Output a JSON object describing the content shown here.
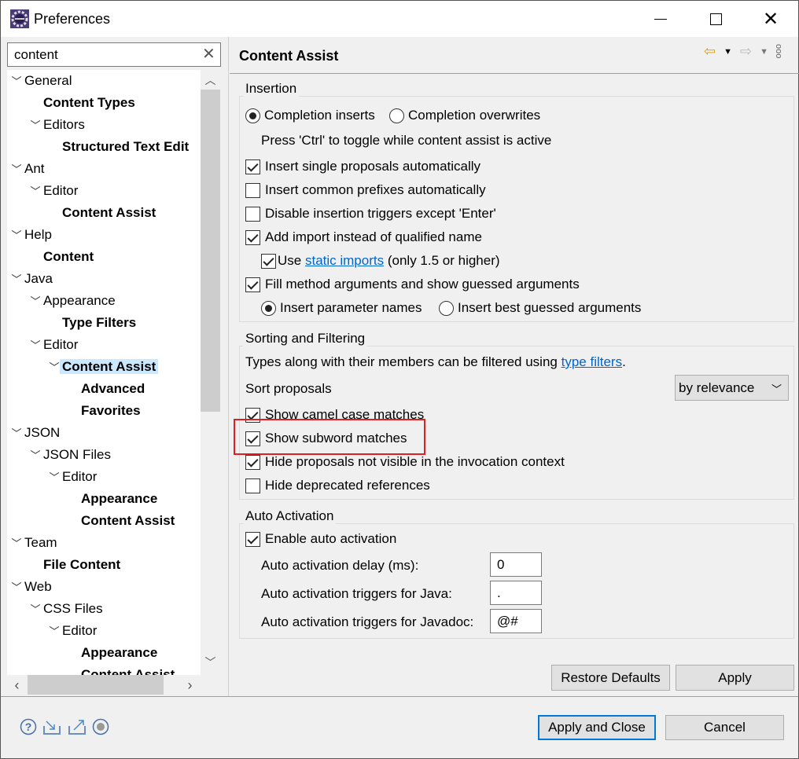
{
  "window": {
    "title": "Preferences",
    "icon": "eclipse-gear-icon",
    "controls": [
      "minimize",
      "maximize",
      "close"
    ]
  },
  "search": {
    "value": "content"
  },
  "tree": [
    {
      "label": "General",
      "level": 0,
      "expanded": true
    },
    {
      "label": "Content Types",
      "level": 1,
      "leaf": true
    },
    {
      "label": "Editors",
      "level": 1,
      "expanded": true
    },
    {
      "label": "Structured Text Edit",
      "level": 2,
      "leaf": true
    },
    {
      "label": "Ant",
      "level": 0,
      "expanded": true
    },
    {
      "label": "Editor",
      "level": 1,
      "expanded": true
    },
    {
      "label": "Content Assist",
      "level": 2,
      "leaf": true
    },
    {
      "label": "Help",
      "level": 0,
      "expanded": true
    },
    {
      "label": "Content",
      "level": 1,
      "leaf": true
    },
    {
      "label": "Java",
      "level": 0,
      "expanded": true
    },
    {
      "label": "Appearance",
      "level": 1,
      "expanded": true
    },
    {
      "label": "Type Filters",
      "level": 2,
      "leaf": true
    },
    {
      "label": "Editor",
      "level": 1,
      "expanded": true
    },
    {
      "label": "Content Assist",
      "level": 2,
      "expanded": true,
      "bold": true,
      "selected": true
    },
    {
      "label": "Advanced",
      "level": 3,
      "leaf": true
    },
    {
      "label": "Favorites",
      "level": 3,
      "leaf": true
    },
    {
      "label": "JSON",
      "level": 0,
      "expanded": true
    },
    {
      "label": "JSON Files",
      "level": 1,
      "expanded": true
    },
    {
      "label": "Editor",
      "level": 2,
      "expanded": true
    },
    {
      "label": "Appearance",
      "level": 3,
      "leaf": true
    },
    {
      "label": "Content Assist",
      "level": 3,
      "leaf": true
    },
    {
      "label": "Team",
      "level": 0,
      "expanded": true
    },
    {
      "label": "File Content",
      "level": 1,
      "leaf": true
    },
    {
      "label": "Web",
      "level": 0,
      "expanded": true
    },
    {
      "label": "CSS Files",
      "level": 1,
      "expanded": true
    },
    {
      "label": "Editor",
      "level": 2,
      "expanded": true
    },
    {
      "label": "Appearance",
      "level": 3,
      "leaf": true
    },
    {
      "label": "Content Assist",
      "level": 3,
      "leaf": true
    }
  ],
  "page": {
    "title": "Content Assist",
    "insertion": {
      "label": "Insertion",
      "radio_inserts": "Completion inserts",
      "radio_overwrites": "Completion overwrites",
      "inserts_selected": true,
      "hint": "Press 'Ctrl' to toggle while content assist is active",
      "single_proposals": {
        "label": "Insert single proposals automatically",
        "checked": true
      },
      "common_prefixes": {
        "label": "Insert common prefixes automatically",
        "checked": false
      },
      "disable_triggers": {
        "label": "Disable insertion triggers except 'Enter'",
        "checked": false
      },
      "add_import": {
        "label": "Add import instead of qualified name",
        "checked": true
      },
      "use_static": {
        "label": "Use",
        "link": "static imports",
        "suffix": "(only 1.5 or higher)",
        "checked": true
      },
      "fill_args": {
        "label": "Fill method arguments and show guessed arguments",
        "checked": true
      },
      "radio_param_names": "Insert parameter names",
      "radio_best_guessed": "Insert best guessed arguments",
      "param_names_selected": true
    },
    "sorting": {
      "label": "Sorting and Filtering",
      "desc": "Types along with their members can be filtered using",
      "desc_link": "type filters",
      "desc_end": ".",
      "sort_label": "Sort proposals",
      "sort_value": "by relevance",
      "camel_case": {
        "label": "Show camel case matches",
        "checked": true
      },
      "subword": {
        "label": "Show subword matches",
        "checked": true
      },
      "hide_not_visible": {
        "label": "Hide proposals not visible in the invocation context",
        "checked": true
      },
      "hide_deprecated": {
        "label": "Hide deprecated references",
        "checked": false
      },
      "highlight_color": "#e02020"
    },
    "auto": {
      "label": "Auto Activation",
      "enable": {
        "label": "Enable auto activation",
        "checked": true
      },
      "delay_label": "Auto activation delay (ms):",
      "delay_value": "0",
      "java_label": "Auto activation triggers for Java:",
      "java_value": ".",
      "javadoc_label": "Auto activation triggers for Javadoc:",
      "javadoc_value": "@#"
    },
    "restore_defaults": "Restore Defaults",
    "apply": "Apply"
  },
  "footer": {
    "apply_close": "Apply and Close",
    "cancel": "Cancel",
    "icons": [
      "help-icon",
      "import-icon",
      "export-icon",
      "record-icon"
    ]
  }
}
